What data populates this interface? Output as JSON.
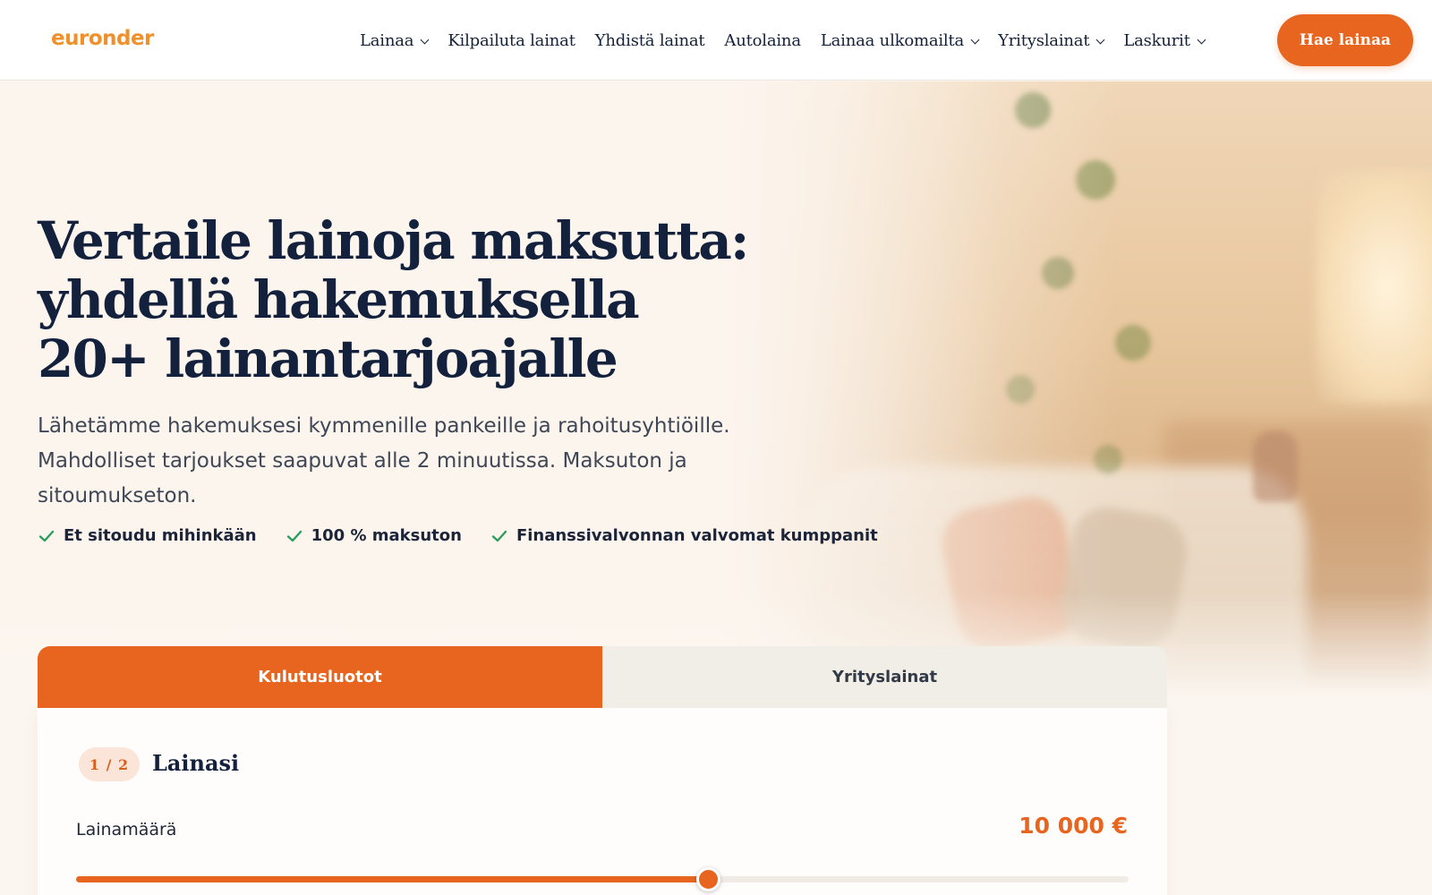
{
  "header": {
    "logo": "euronder",
    "nav": [
      {
        "label": "Lainaa",
        "has_dropdown": true
      },
      {
        "label": "Kilpailuta lainat",
        "has_dropdown": false
      },
      {
        "label": "Yhdistä lainat",
        "has_dropdown": false
      },
      {
        "label": "Autolaina",
        "has_dropdown": false
      },
      {
        "label": "Lainaa ulkomailta",
        "has_dropdown": true
      },
      {
        "label": "Yrityslainat",
        "has_dropdown": true
      },
      {
        "label": "Laskurit",
        "has_dropdown": true
      }
    ],
    "cta_label": "Hae lainaa"
  },
  "hero": {
    "title": "Vertaile lainoja maksutta: yhdellä hakemuksella 20+ lainantarjoajalle",
    "description": "Lähetämme hakemuksesi kymmenille pankeille ja rahoitusyhtiöille. Mahdolliset tarjoukset saapuvat alle 2 minuutissa. Maksuton ja sitoumukseton.",
    "checks": [
      "Et sitoudu mihinkään",
      "100 % maksuton",
      "Finanssivalvonnan valvomat kumppanit"
    ]
  },
  "form": {
    "tabs": [
      {
        "label": "Kulutusluotot",
        "active": true
      },
      {
        "label": "Yrityslainat",
        "active": false
      }
    ],
    "step_badge": "1 / 2",
    "step_title": "Lainasi",
    "amount_label": "Lainamäärä",
    "amount_value": "10 000 €",
    "slider_fraction": 0.6
  },
  "colors": {
    "accent": "#e8651f",
    "logo": "#f0902a",
    "heading": "#13213d",
    "check": "#2a9d5c"
  }
}
